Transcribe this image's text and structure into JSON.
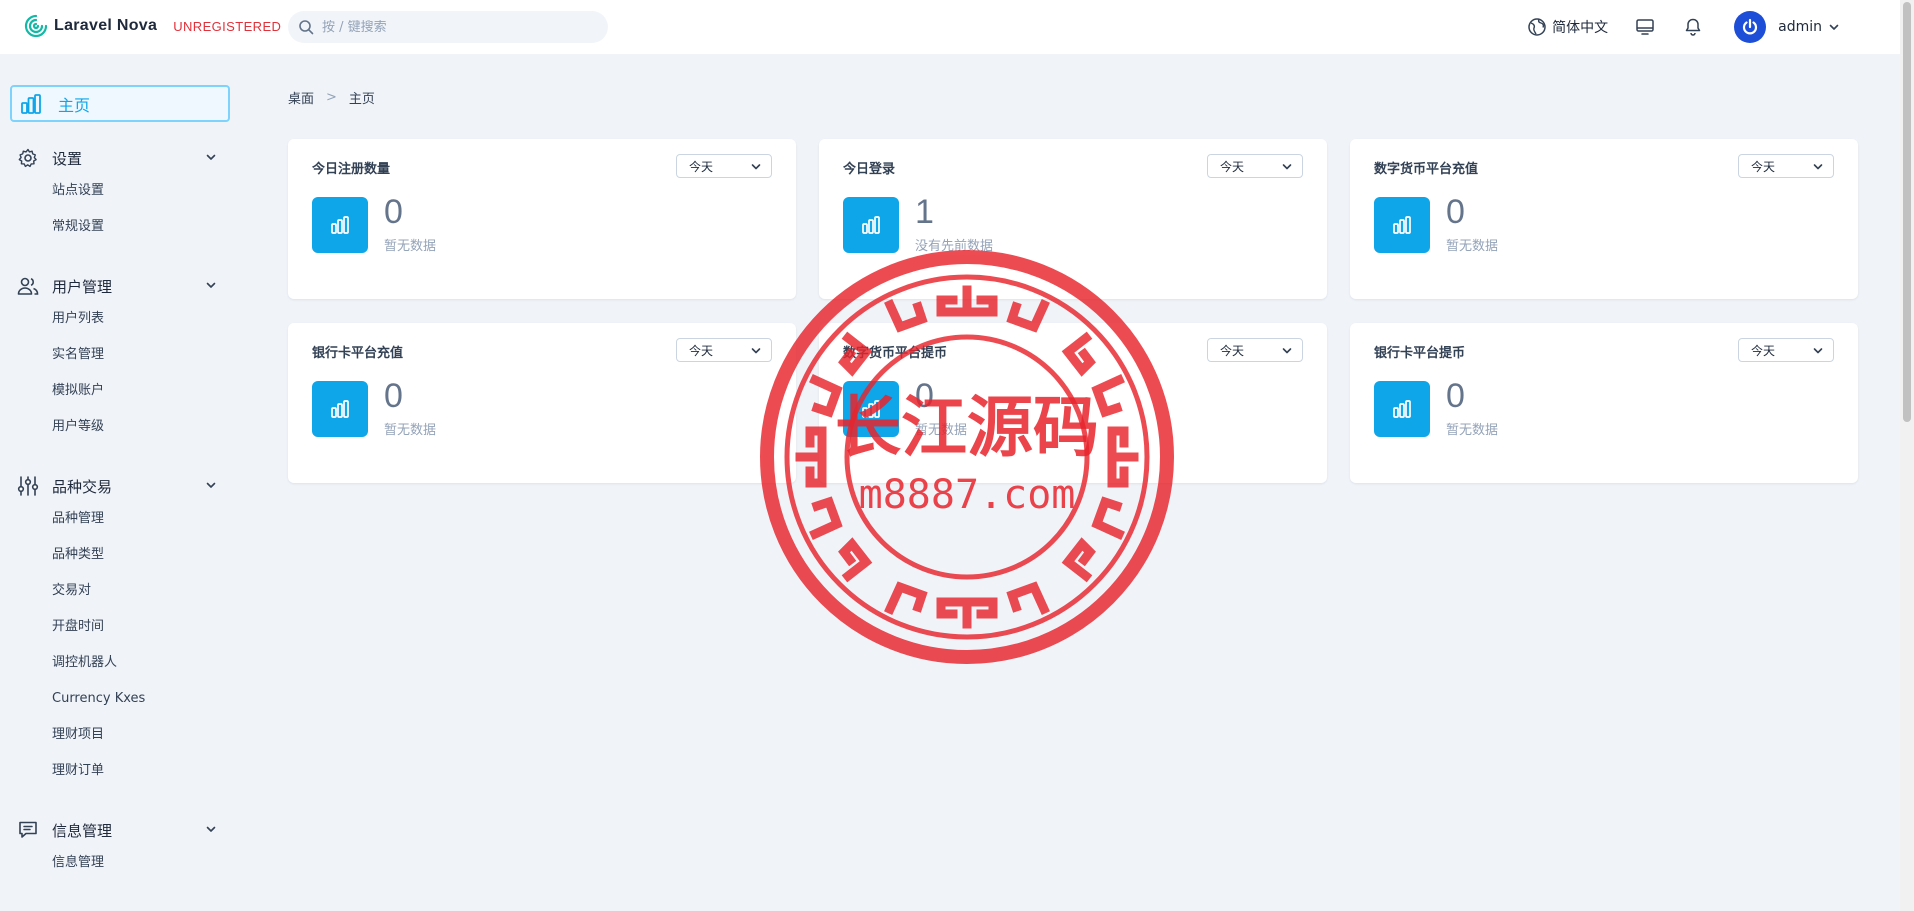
{
  "app": {
    "name": "Laravel Nova",
    "badge": "UNREGISTERED"
  },
  "search": {
    "placeholder": "按 / 键搜索"
  },
  "header": {
    "language": "简体中文",
    "username": "admin"
  },
  "sidebar": {
    "home": "主页",
    "groups": [
      {
        "label": "设置",
        "icon": "gear-icon",
        "items": [
          "站点设置",
          "常规设置"
        ]
      },
      {
        "label": "用户管理",
        "icon": "users-icon",
        "items": [
          "用户列表",
          "实名管理",
          "模拟账户",
          "用户等级"
        ]
      },
      {
        "label": "品种交易",
        "icon": "sliders-icon",
        "items": [
          "品种管理",
          "品种类型",
          "交易对",
          "开盘时间",
          "调控机器人",
          "Currency Kxes",
          "理财项目",
          "理财订单"
        ]
      },
      {
        "label": "信息管理",
        "icon": "message-icon",
        "items": [
          "信息管理"
        ]
      }
    ]
  },
  "breadcrumb": {
    "root": "桌面",
    "current": "主页"
  },
  "cards": [
    {
      "title": "今日注册数量",
      "range": "今天",
      "value": "0",
      "note": "暂无数据"
    },
    {
      "title": "今日登录",
      "range": "今天",
      "value": "1",
      "note": "没有先前数据"
    },
    {
      "title": "数字货币平台充值",
      "range": "今天",
      "value": "0",
      "note": "暂无数据"
    },
    {
      "title": "银行卡平台充值",
      "range": "今天",
      "value": "0",
      "note": "暂无数据"
    },
    {
      "title": "数字货币平台提币",
      "range": "今天",
      "value": "0",
      "note": "暂无数据"
    },
    {
      "title": "银行卡平台提币",
      "range": "今天",
      "value": "0",
      "note": "暂无数据"
    }
  ],
  "watermark": {
    "text": "长江源码",
    "url": "m8887.com"
  },
  "colors": {
    "accent": "#0ea5e9",
    "unregistered": "#e2313a",
    "stamp": "#e8242c"
  }
}
